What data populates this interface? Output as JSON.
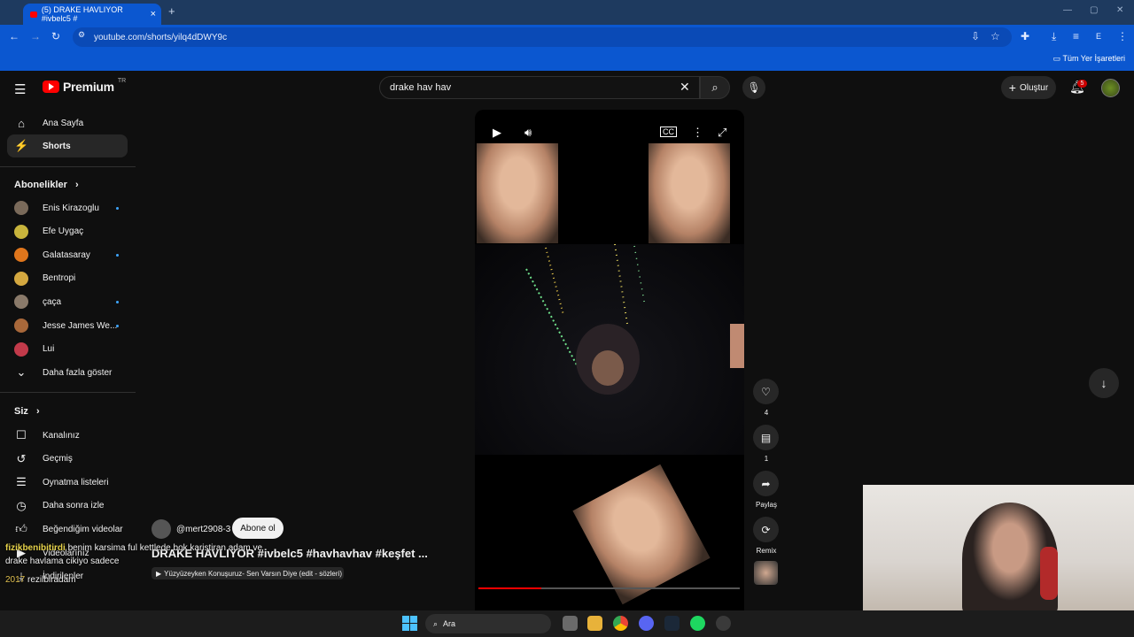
{
  "browser": {
    "tab_title": "(5) DRAKE HAVLIYOR #ivbelc5 #",
    "url": "youtube.com/shorts/yilq4dDWY9c",
    "bookmarks_label": "Tüm Yer İşaretleri",
    "profile_initial": "E"
  },
  "header": {
    "logo": "Premium",
    "logo_region": "TR",
    "search_value": "drake hav hav",
    "create_label": "Oluştur",
    "notification_count": "5"
  },
  "sidebar": {
    "main": [
      {
        "label": "Ana Sayfa",
        "icon": "home-icon"
      },
      {
        "label": "Shorts",
        "icon": "shorts-icon"
      }
    ],
    "subscriptions_title": "Abonelikler",
    "subscriptions": [
      {
        "label": "Enis Kirazoglu",
        "color": "#7a6a5a",
        "new": true
      },
      {
        "label": "Efe Uygaç",
        "color": "#c8b43c",
        "new": false
      },
      {
        "label": "Galatasaray",
        "color": "#e0761c",
        "new": true
      },
      {
        "label": "Bentropi",
        "color": "#d4a840",
        "new": false
      },
      {
        "label": "çaça",
        "color": "#8a7a6a",
        "new": true
      },
      {
        "label": "Jesse James We...",
        "color": "#a8683a",
        "new": true
      },
      {
        "label": "Lui",
        "color": "#c23a4a",
        "new": false
      }
    ],
    "show_more": "Daha fazla göster",
    "you_title": "Siz",
    "you_items": [
      {
        "label": "Kanalınız",
        "icon": "user-icon"
      },
      {
        "label": "Geçmiş",
        "icon": "history-icon"
      },
      {
        "label": "Oynatma listeleri",
        "icon": "playlist-icon"
      },
      {
        "label": "Daha sonra izle",
        "icon": "clock-icon"
      },
      {
        "label": "Beğendiğim videolar",
        "icon": "like-icon"
      },
      {
        "label": "Videolarınız",
        "icon": "video-icon"
      },
      {
        "label": "İndirilenler",
        "icon": "download-icon"
      }
    ]
  },
  "short": {
    "channel": "@mert2908-3",
    "subscribe_label": "Abone ol",
    "title": "DRAKE HAVLIYOR #ivbelc5 #havhavhav #keşfet ...",
    "music": "Yüzyüzeyken Konuşuruz- Sen Varsın Diye (edit - sözleri)",
    "progress": 0.24
  },
  "actions": {
    "likes": "4",
    "comments": "1",
    "share_label": "Paylaş",
    "remix_label": "Remix"
  },
  "chat": {
    "user": "fizikbenibitirdi",
    "line1": "benim karsima ful kettlede bok karistiran adam ve",
    "line2": "drake havlama cikiyo sadece",
    "line3_prefix": "2017",
    "line3": "rezilbiradam"
  },
  "taskbar": {
    "search_placeholder": "Ara"
  }
}
